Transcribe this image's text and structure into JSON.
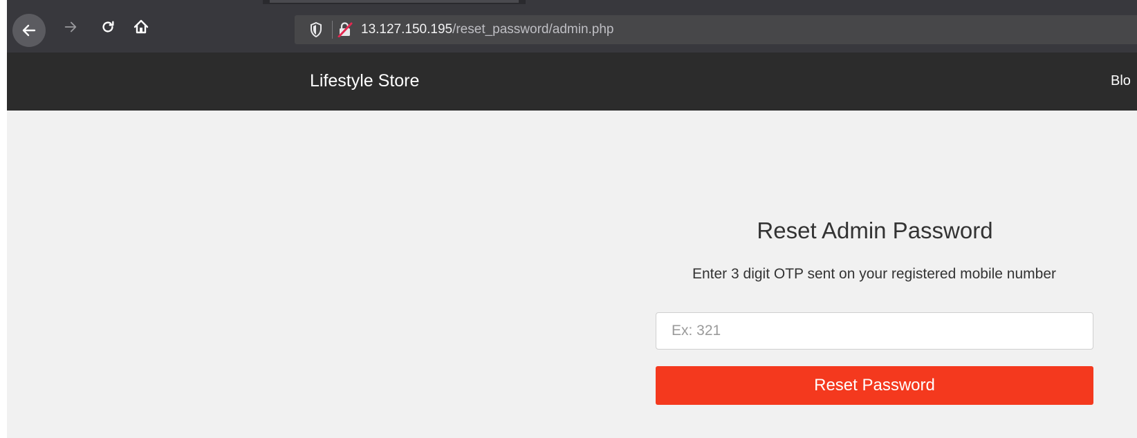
{
  "browser": {
    "url_host": "13.127.150.195",
    "url_path": "/reset_password/admin.php",
    "icons": [
      "back-icon",
      "forward-icon",
      "reload-icon",
      "home-icon",
      "shield-icon",
      "insecure-lock-icon"
    ]
  },
  "header": {
    "brand": "Lifestyle Store",
    "nav_link": "Blo"
  },
  "reset_form": {
    "title": "Reset Admin Password",
    "description": "Enter 3 digit OTP sent on your registered mobile number",
    "otp_placeholder": "Ex: 321",
    "otp_value": "",
    "submit_label": "Reset Password"
  },
  "colors": {
    "header_bg": "#2c2c2c",
    "page_bg": "#f1f1f1",
    "button_bg": "#f4391e"
  }
}
